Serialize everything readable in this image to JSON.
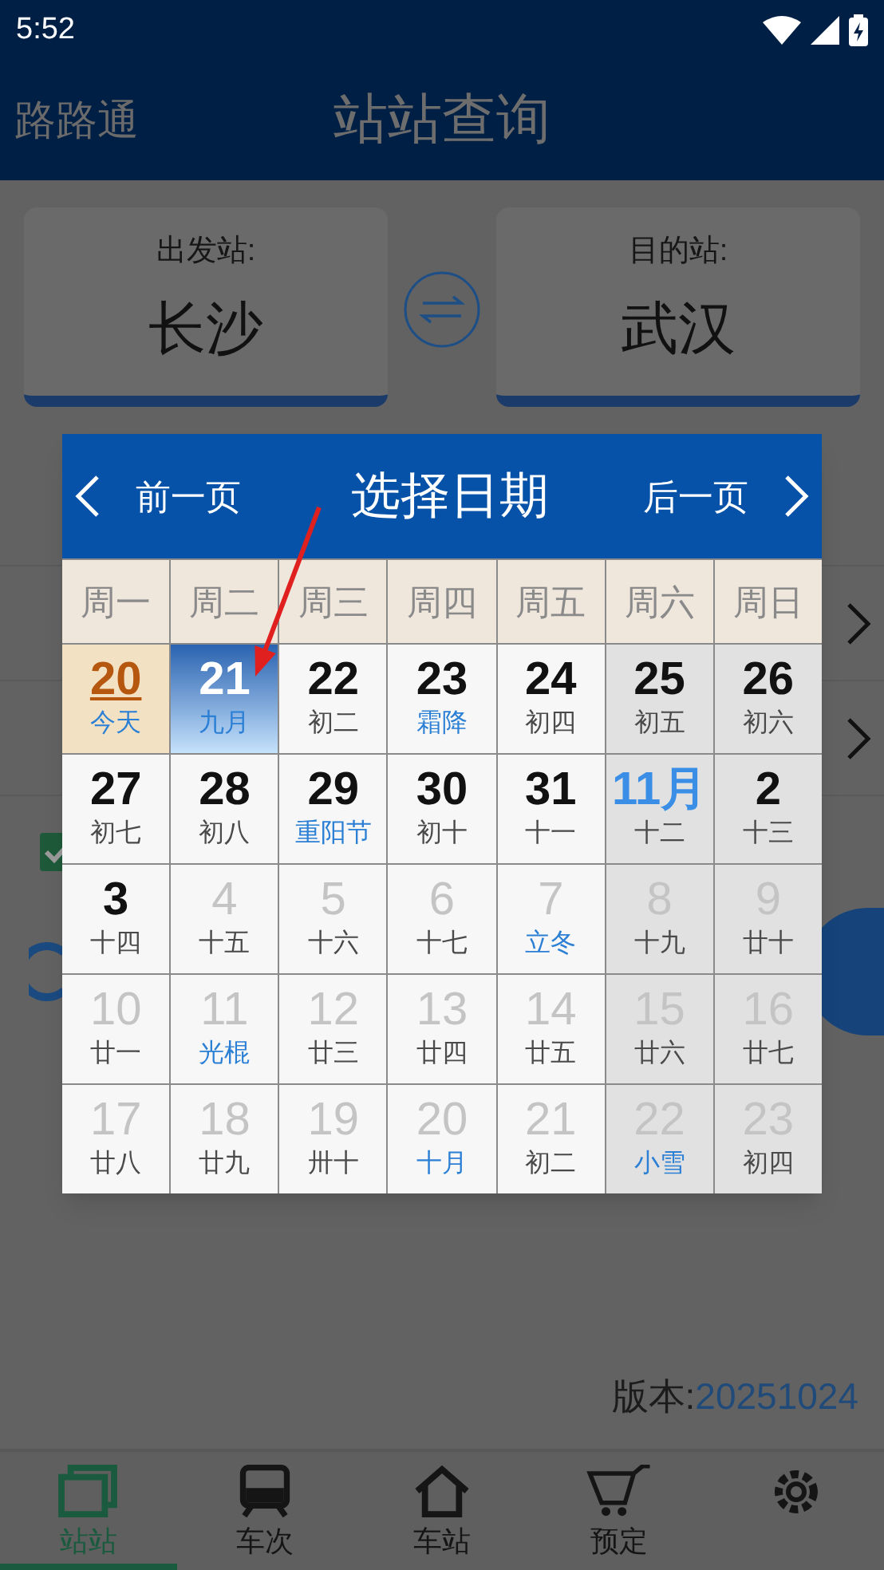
{
  "status_bar": {
    "time": "5:52"
  },
  "header": {
    "app_name": "路路通",
    "title": "站站查询"
  },
  "stations": {
    "from": {
      "label": "出发站:",
      "value": "长沙"
    },
    "to": {
      "label": "目的站:",
      "value": "武汉"
    }
  },
  "checkbox": {
    "checked": true
  },
  "version": {
    "label": "版本:",
    "value": "20251024"
  },
  "bottom_nav": [
    {
      "label": "站站",
      "selected": true
    },
    {
      "label": "车次",
      "selected": false
    },
    {
      "label": "车站",
      "selected": false
    },
    {
      "label": "预定",
      "selected": false
    },
    {
      "selected": false
    }
  ],
  "date_dialog": {
    "prev": "前一页",
    "title": "选择日期",
    "next": "后一页",
    "weekdays": [
      "周一",
      "周二",
      "周三",
      "周四",
      "周五",
      "周六",
      "周日"
    ],
    "cells": [
      {
        "day": "20",
        "lunar": "今天",
        "kind": "date",
        "today": true,
        "selected": false,
        "disabled": false,
        "festival": true
      },
      {
        "day": "21",
        "lunar": "九月",
        "kind": "date",
        "today": false,
        "selected": true,
        "disabled": false,
        "festival": true
      },
      {
        "day": "22",
        "lunar": "初二",
        "kind": "date",
        "today": false,
        "selected": false,
        "disabled": false,
        "festival": false
      },
      {
        "day": "23",
        "lunar": "霜降",
        "kind": "date",
        "today": false,
        "selected": false,
        "disabled": false,
        "festival": true
      },
      {
        "day": "24",
        "lunar": "初四",
        "kind": "date",
        "today": false,
        "selected": false,
        "disabled": false,
        "festival": false
      },
      {
        "day": "25",
        "lunar": "初五",
        "kind": "date",
        "today": false,
        "selected": false,
        "disabled": false,
        "festival": false
      },
      {
        "day": "26",
        "lunar": "初六",
        "kind": "date",
        "today": false,
        "selected": false,
        "disabled": false,
        "festival": false
      },
      {
        "day": "27",
        "lunar": "初七",
        "kind": "date",
        "today": false,
        "selected": false,
        "disabled": false,
        "festival": false
      },
      {
        "day": "28",
        "lunar": "初八",
        "kind": "date",
        "today": false,
        "selected": false,
        "disabled": false,
        "festival": false
      },
      {
        "day": "29",
        "lunar": "重阳节",
        "kind": "date",
        "today": false,
        "selected": false,
        "disabled": false,
        "festival": true
      },
      {
        "day": "30",
        "lunar": "初十",
        "kind": "date",
        "today": false,
        "selected": false,
        "disabled": false,
        "festival": false
      },
      {
        "day": "31",
        "lunar": "十一",
        "kind": "date",
        "today": false,
        "selected": false,
        "disabled": false,
        "festival": false
      },
      {
        "day": "11月",
        "lunar": "十二",
        "kind": "month",
        "today": false,
        "selected": false,
        "disabled": false,
        "festival": false
      },
      {
        "day": "2",
        "lunar": "十三",
        "kind": "date",
        "today": false,
        "selected": false,
        "disabled": false,
        "festival": false
      },
      {
        "day": "3",
        "lunar": "十四",
        "kind": "date",
        "today": false,
        "selected": false,
        "disabled": false,
        "festival": false
      },
      {
        "day": "4",
        "lunar": "十五",
        "kind": "date",
        "today": false,
        "selected": false,
        "disabled": true,
        "festival": false
      },
      {
        "day": "5",
        "lunar": "十六",
        "kind": "date",
        "today": false,
        "selected": false,
        "disabled": true,
        "festival": false
      },
      {
        "day": "6",
        "lunar": "十七",
        "kind": "date",
        "today": false,
        "selected": false,
        "disabled": true,
        "festival": false
      },
      {
        "day": "7",
        "lunar": "立冬",
        "kind": "date",
        "today": false,
        "selected": false,
        "disabled": true,
        "festival": true
      },
      {
        "day": "8",
        "lunar": "十九",
        "kind": "date",
        "today": false,
        "selected": false,
        "disabled": true,
        "festival": false
      },
      {
        "day": "9",
        "lunar": "廿十",
        "kind": "date",
        "today": false,
        "selected": false,
        "disabled": true,
        "festival": false
      },
      {
        "day": "10",
        "lunar": "廿一",
        "kind": "date",
        "today": false,
        "selected": false,
        "disabled": true,
        "festival": false
      },
      {
        "day": "11",
        "lunar": "光棍",
        "kind": "date",
        "today": false,
        "selected": false,
        "disabled": true,
        "festival": true
      },
      {
        "day": "12",
        "lunar": "廿三",
        "kind": "date",
        "today": false,
        "selected": false,
        "disabled": true,
        "festival": false
      },
      {
        "day": "13",
        "lunar": "廿四",
        "kind": "date",
        "today": false,
        "selected": false,
        "disabled": true,
        "festival": false
      },
      {
        "day": "14",
        "lunar": "廿五",
        "kind": "date",
        "today": false,
        "selected": false,
        "disabled": true,
        "festival": false
      },
      {
        "day": "15",
        "lunar": "廿六",
        "kind": "date",
        "today": false,
        "selected": false,
        "disabled": true,
        "festival": false
      },
      {
        "day": "16",
        "lunar": "廿七",
        "kind": "date",
        "today": false,
        "selected": false,
        "disabled": true,
        "festival": false
      },
      {
        "day": "17",
        "lunar": "廿八",
        "kind": "date",
        "today": false,
        "selected": false,
        "disabled": true,
        "festival": false
      },
      {
        "day": "18",
        "lunar": "廿九",
        "kind": "date",
        "today": false,
        "selected": false,
        "disabled": true,
        "festival": false
      },
      {
        "day": "19",
        "lunar": "卅十",
        "kind": "date",
        "today": false,
        "selected": false,
        "disabled": true,
        "festival": false
      },
      {
        "day": "20",
        "lunar": "十月",
        "kind": "date",
        "today": false,
        "selected": false,
        "disabled": true,
        "festival": true
      },
      {
        "day": "21",
        "lunar": "初二",
        "kind": "date",
        "today": false,
        "selected": false,
        "disabled": true,
        "festival": false
      },
      {
        "day": "22",
        "lunar": "小雪",
        "kind": "date",
        "today": false,
        "selected": false,
        "disabled": true,
        "festival": true
      },
      {
        "day": "23",
        "lunar": "初四",
        "kind": "date",
        "today": false,
        "selected": false,
        "disabled": true,
        "festival": false
      }
    ]
  }
}
